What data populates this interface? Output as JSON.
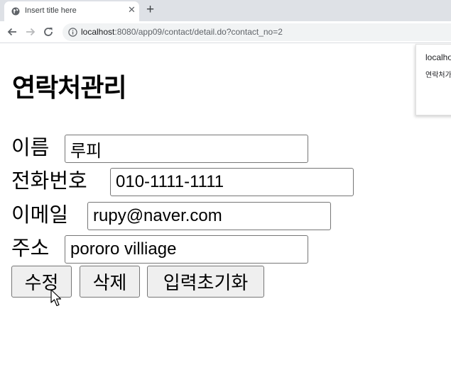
{
  "browser": {
    "tab_title": "Insert title here",
    "close_glyph": "✕",
    "new_tab_glyph": "+",
    "url_host": "localhost",
    "url_rest": ":8080/app09/contact/detail.do?contact_no=2"
  },
  "popup": {
    "origin": "localhost",
    "message": "연락처가"
  },
  "page": {
    "title": "연락처관리"
  },
  "form": {
    "name_label": "이름",
    "name_value": "루피",
    "phone_label": "전화번호",
    "phone_value": "010-1111-1111",
    "email_label": "이메일",
    "email_value": "rupy@naver.com",
    "address_label": "주소",
    "address_value": "pororo villiage"
  },
  "buttons": {
    "update": "수정",
    "delete": "삭제",
    "reset": "입력초기화"
  },
  "colors": {
    "tabstrip": "#dee1e6",
    "omnibox": "#f1f3f4",
    "button_face": "#efefef",
    "input_border": "#767676"
  }
}
